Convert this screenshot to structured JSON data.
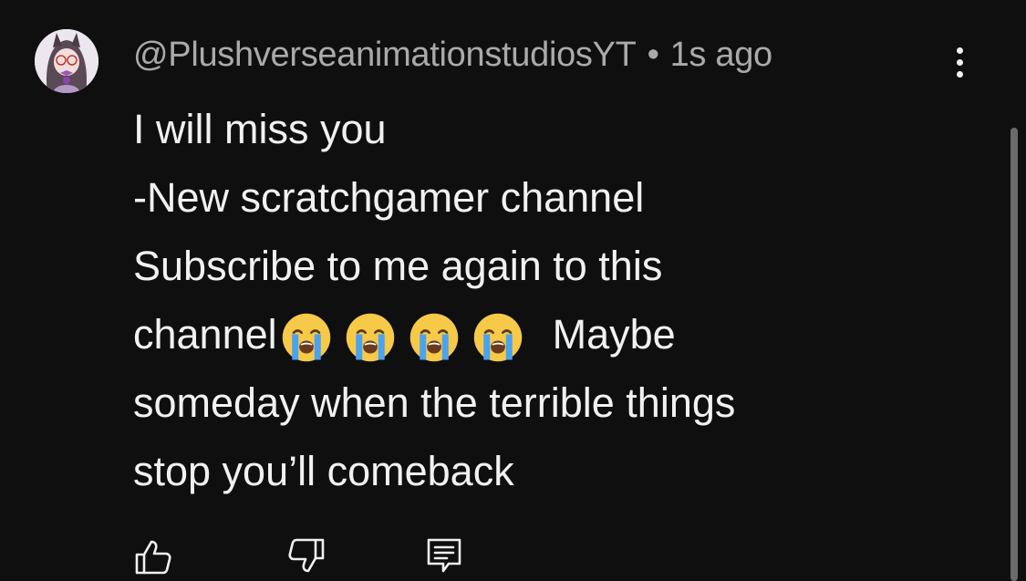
{
  "comment": {
    "author": "@PlushverseanimationstudiosYT",
    "separator": "•",
    "time": "1s ago",
    "lines": [
      "I will miss you",
      "-New scratchgamer channel",
      "Subscribe to me again to this",
      "channel",
      "Maybe",
      "someday when the terrible things",
      "stop you’ll comeback"
    ],
    "emojis": [
      "loudly-crying-face",
      "loudly-crying-face",
      "loudly-crying-face",
      "loudly-crying-face"
    ]
  },
  "actions": {
    "like_icon": "thumbs-up-icon",
    "dislike_icon": "thumbs-down-icon",
    "reply_icon": "reply-icon"
  },
  "colors": {
    "background": "#0f0f0f",
    "text": "#f1f1f1",
    "meta": "#aaaaaa"
  }
}
